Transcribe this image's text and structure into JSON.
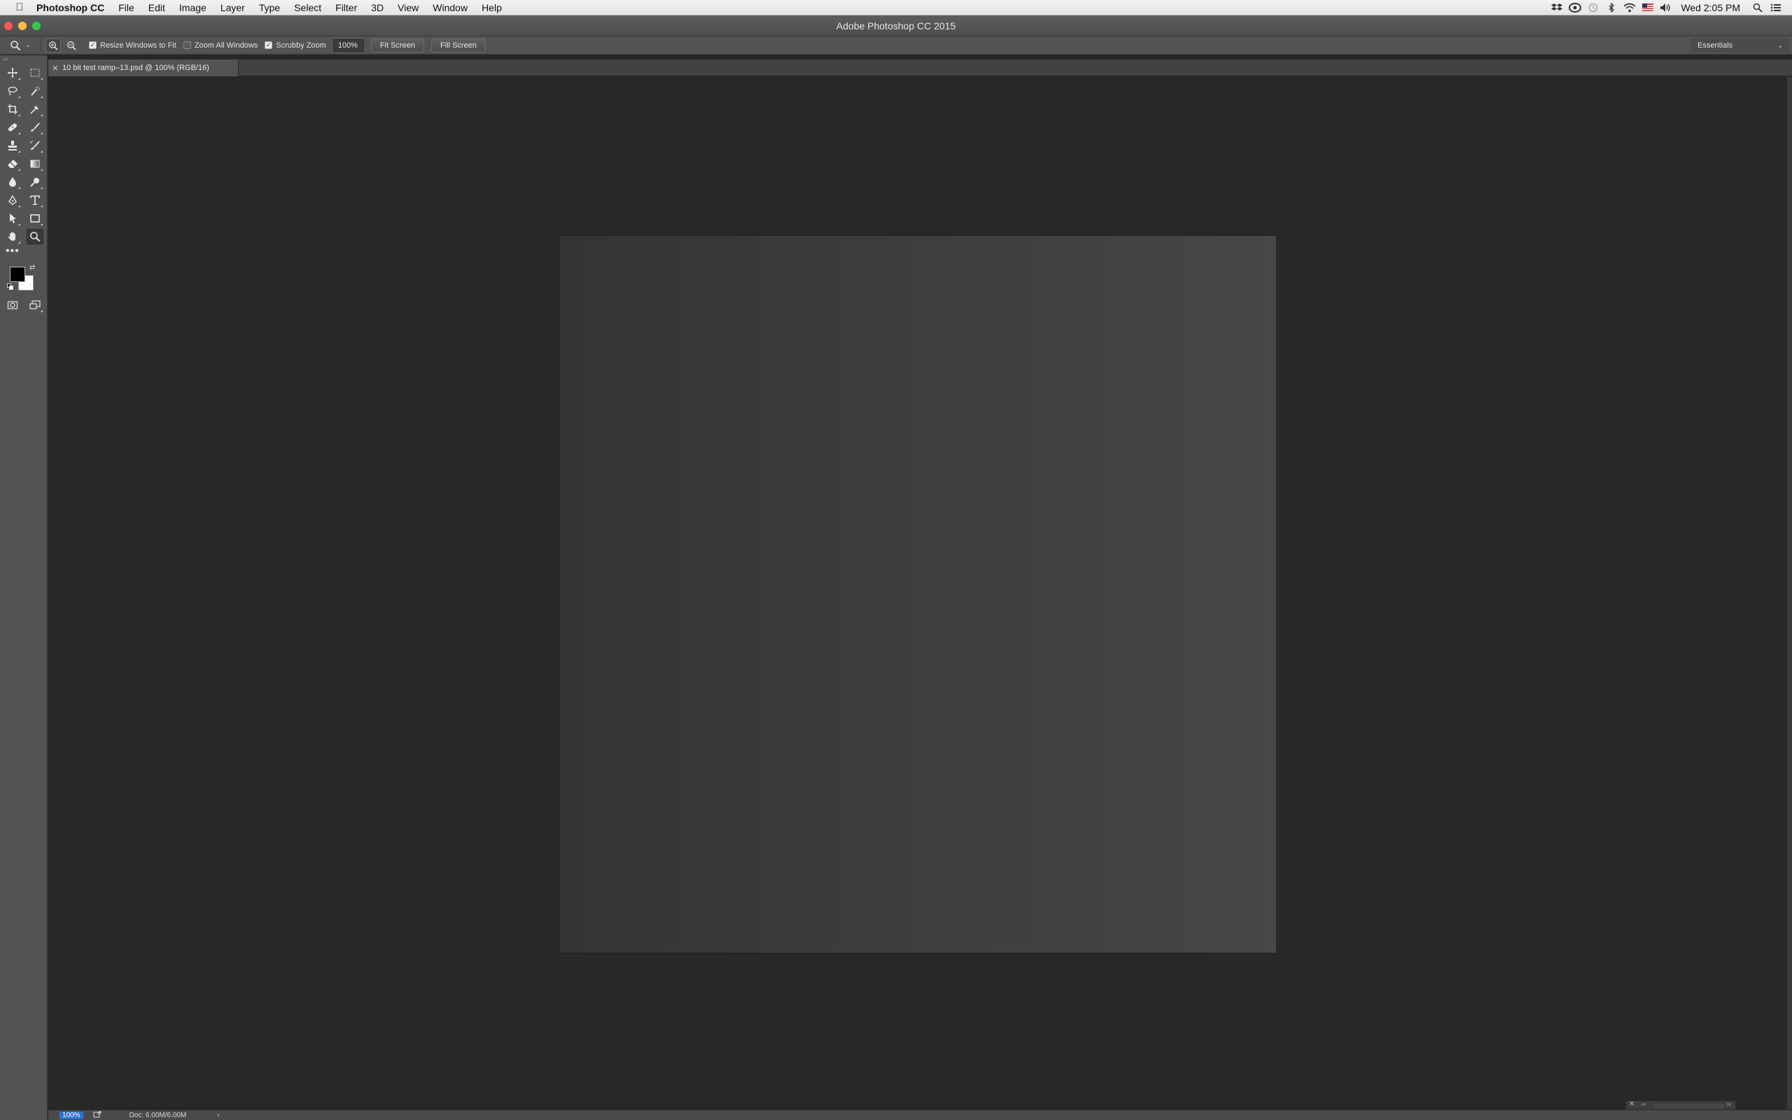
{
  "menubar": {
    "app_name": "Photoshop CC",
    "items": [
      "File",
      "Edit",
      "Image",
      "Layer",
      "Type",
      "Select",
      "Filter",
      "3D",
      "View",
      "Window",
      "Help"
    ],
    "clock": "Wed 2:05 PM",
    "tray_icons": [
      "dropbox-icon",
      "creative-cloud-icon",
      "time-machine-icon",
      "bluetooth-icon",
      "wifi-icon",
      "us-flag-icon",
      "volume-icon"
    ]
  },
  "window": {
    "title": "Adobe Photoshop CC 2015"
  },
  "options": {
    "resize_windows_label": "Resize Windows to Fit",
    "resize_windows_checked": true,
    "zoom_all_label": "Zoom All Windows",
    "zoom_all_checked": false,
    "scrubby_label": "Scrubby Zoom",
    "scrubby_checked": true,
    "zoom_value": "100%",
    "fit_screen_label": "Fit Screen",
    "fill_screen_label": "Fill Screen",
    "workspace": "Essentials"
  },
  "document": {
    "tab_title": "10 bit test ramp–13.psd @ 100% (RGB/16)",
    "canvas_gradient": [
      "#343434",
      "#474747"
    ]
  },
  "status": {
    "zoom": "100%",
    "doc_info": "Doc: 6.00M/6.00M",
    "arrow": "›"
  },
  "colors": {
    "foreground": "#000000",
    "background": "#ffffff"
  }
}
